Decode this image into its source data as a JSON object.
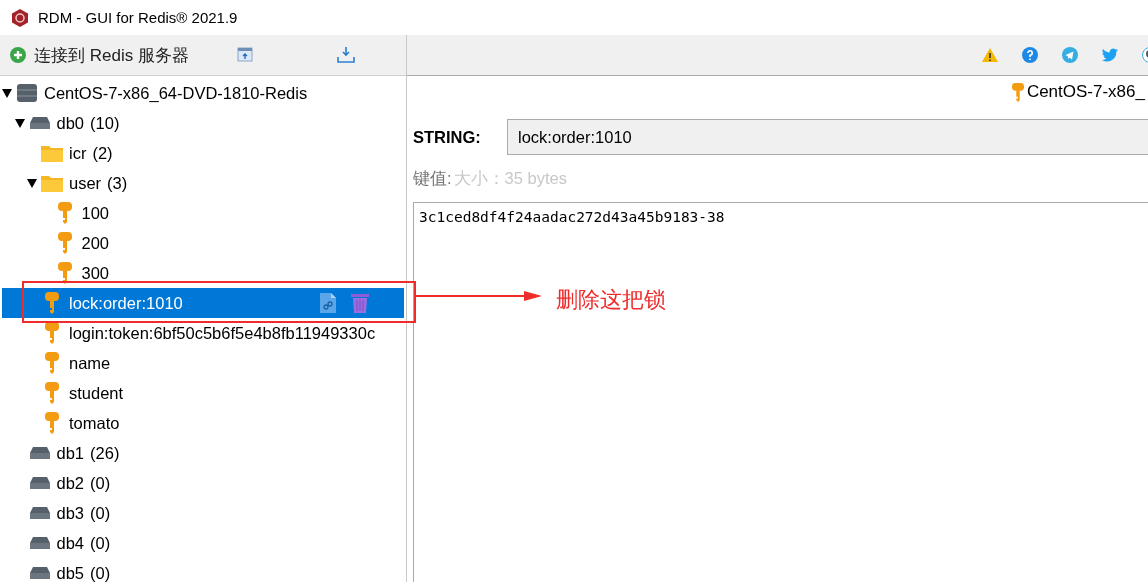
{
  "window": {
    "title": "RDM - GUI for Redis® 2021.9"
  },
  "toolbar": {
    "connect_button": "连接到 Redis 服务器"
  },
  "tree": [
    {
      "kind": "server",
      "label": "CentOS-7-x86_64-DVD-1810-Redis",
      "expanded": true,
      "selected": false,
      "children": [
        {
          "kind": "db",
          "label": "db0",
          "count": "(10)",
          "expanded": true,
          "selected": false,
          "children": [
            {
              "kind": "folder",
              "label": "icr",
              "count": "(2)",
              "expanded": false,
              "selected": false
            },
            {
              "kind": "folder",
              "label": "user",
              "count": "(3)",
              "expanded": true,
              "selected": false,
              "children": [
                {
                  "kind": "key",
                  "label": "100",
                  "selected": false
                },
                {
                  "kind": "key",
                  "label": "200",
                  "selected": false
                },
                {
                  "kind": "key",
                  "label": "300",
                  "selected": false
                }
              ]
            },
            {
              "kind": "key",
              "label": "lock:order:1010",
              "selected": true
            },
            {
              "kind": "key",
              "label": "login:token:6bf50c5b6f5e4b8fb11949330c",
              "selected": false
            },
            {
              "kind": "key",
              "label": "name",
              "selected": false
            },
            {
              "kind": "key",
              "label": "student",
              "selected": false
            },
            {
              "kind": "key",
              "label": "tomato",
              "selected": false
            }
          ]
        },
        {
          "kind": "db",
          "label": "db1",
          "count": "(26)",
          "expanded": false,
          "selected": false
        },
        {
          "kind": "db",
          "label": "db2",
          "count": "(0)",
          "expanded": false,
          "selected": false
        },
        {
          "kind": "db",
          "label": "db3",
          "count": "(0)",
          "expanded": false,
          "selected": false
        },
        {
          "kind": "db",
          "label": "db4",
          "count": "(0)",
          "expanded": false,
          "selected": false
        },
        {
          "kind": "db",
          "label": "db5",
          "count": "(0)",
          "expanded": false,
          "selected": false
        }
      ]
    }
  ],
  "tab": {
    "label": "CentOS-7-x86_"
  },
  "key_view": {
    "type": "STRING:",
    "key_name": "lock:order:1010",
    "value_label": "键值:",
    "size": "大小：35 bytes",
    "value": "3c1ced8df4f24aadac272d43a45b9183-38"
  },
  "annotation": {
    "text": "删除这把锁"
  }
}
